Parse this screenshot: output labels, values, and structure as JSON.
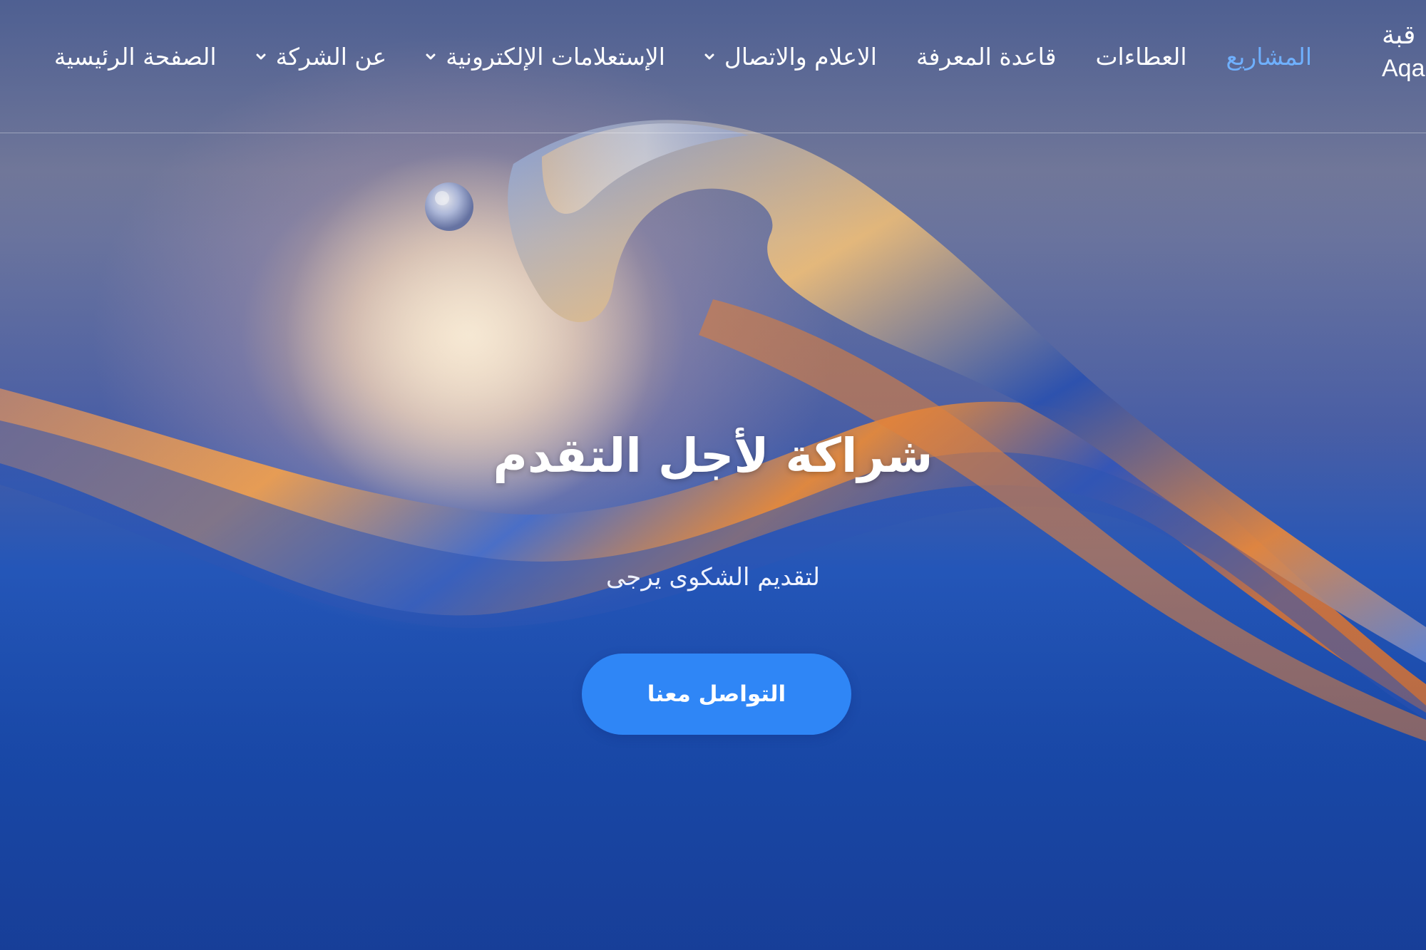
{
  "logo": {
    "arabic": "قبة",
    "latin": "Aqa"
  },
  "nav": {
    "items": [
      {
        "label": "الصفحة الرئيسية",
        "has_dropdown": false
      },
      {
        "label": "عن الشركة",
        "has_dropdown": true
      },
      {
        "label": "الإستعلامات الإلكترونية",
        "has_dropdown": true
      },
      {
        "label": "الاعلام والاتصال",
        "has_dropdown": true
      },
      {
        "label": "قاعدة المعرفة",
        "has_dropdown": false
      },
      {
        "label": "العطاءات",
        "has_dropdown": false
      },
      {
        "label": "المشاريع",
        "has_dropdown": false,
        "active": true
      }
    ],
    "active_color": "#6fb0ff"
  },
  "hero": {
    "title": "شراكة لأجل التقدم",
    "subtitle": "لتقديم الشكوى يرجى",
    "cta_label": "التواصل معنا",
    "cta_color": "#2f86f6"
  }
}
